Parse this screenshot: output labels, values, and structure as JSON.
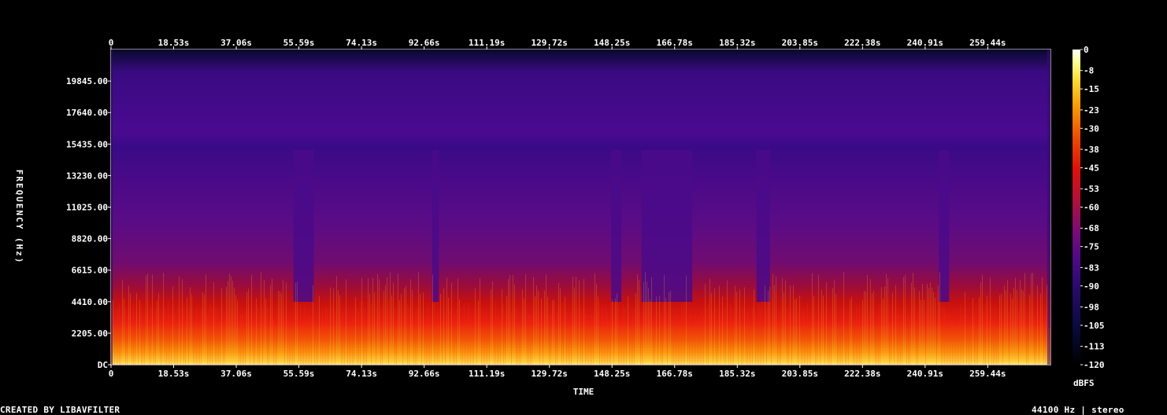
{
  "chart_data": {
    "type": "heatmap",
    "title": "",
    "xlabel": "TIME",
    "ylabel": "FREQUENCY (Hz)",
    "colorbar_label": "dBFS",
    "x_ticks": [
      "0",
      "18.53s",
      "37.06s",
      "55.59s",
      "74.13s",
      "92.66s",
      "111.19s",
      "129.72s",
      "148.25s",
      "166.78s",
      "185.32s",
      "203.85s",
      "222.38s",
      "240.91s",
      "259.44s"
    ],
    "x_tick_values": [
      0,
      18.53,
      37.06,
      55.59,
      74.13,
      92.66,
      111.19,
      129.72,
      148.25,
      166.78,
      185.32,
      203.85,
      222.38,
      240.91,
      259.44
    ],
    "xlim": [
      0,
      278
    ],
    "y_ticks": [
      "DC",
      "2205.00",
      "4410.00",
      "6615.00",
      "8820.00",
      "11025.00",
      "13230.00",
      "15435.00",
      "17640.00",
      "19845.00"
    ],
    "y_tick_values": [
      0,
      2205,
      4410,
      6615,
      8820,
      11025,
      13230,
      15435,
      17640,
      19845
    ],
    "ylim": [
      0,
      22050
    ],
    "colorbar_ticks": [
      "0",
      "-8",
      "-15",
      "-23",
      "-30",
      "-38",
      "-45",
      "-53",
      "-60",
      "-68",
      "-75",
      "-83",
      "-90",
      "-98",
      "-105",
      "-113",
      "-120"
    ],
    "colorbar_tick_values": [
      0,
      -8,
      -15,
      -23,
      -30,
      -38,
      -45,
      -53,
      -60,
      -68,
      -75,
      -83,
      -90,
      -98,
      -105,
      -113,
      -120
    ],
    "zlim": [
      -120,
      0
    ],
    "quiet_segments_s": [
      [
        54,
        60
      ],
      [
        95,
        97
      ],
      [
        148,
        151
      ],
      [
        157,
        172
      ],
      [
        191,
        195
      ],
      [
        245,
        248
      ]
    ],
    "sample_rate_label": "44100 Hz | stereo",
    "credit": "CREATED BY LIBAVFILTER"
  },
  "colors": {
    "background": "#000000",
    "text": "#ffffff",
    "colormap": [
      "#000000",
      "#0a0a3c",
      "#2a0a6e",
      "#5a0a8c",
      "#8a0a5a",
      "#c8100a",
      "#f05a00",
      "#ffc000",
      "#ffff80",
      "#ffffff"
    ]
  }
}
